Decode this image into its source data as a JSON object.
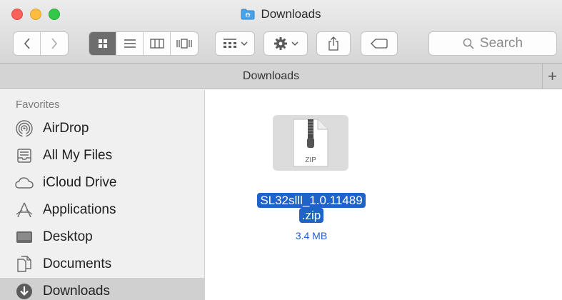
{
  "window": {
    "title": "Downloads"
  },
  "toolbar": {
    "search_placeholder": "Search"
  },
  "tabs": [
    {
      "label": "Downloads"
    }
  ],
  "sidebar": {
    "section_title": "Favorites",
    "items": [
      {
        "label": "AirDrop",
        "icon": "airdrop-icon"
      },
      {
        "label": "All My Files",
        "icon": "all-my-files-icon"
      },
      {
        "label": "iCloud Drive",
        "icon": "icloud-icon"
      },
      {
        "label": "Applications",
        "icon": "applications-icon"
      },
      {
        "label": "Desktop",
        "icon": "desktop-icon"
      },
      {
        "label": "Documents",
        "icon": "documents-icon"
      },
      {
        "label": "Downloads",
        "icon": "downloads-icon",
        "selected": true
      }
    ]
  },
  "content": {
    "file": {
      "name_line1": "SL32slll_1.0.11489",
      "name_line2": ".zip",
      "size": "3.4 MB",
      "type_label": "ZIP"
    }
  },
  "colors": {
    "selection": "#1e63c8",
    "sidebar_bg": "#f0f0f0",
    "active_view": "#6d6d6d"
  }
}
